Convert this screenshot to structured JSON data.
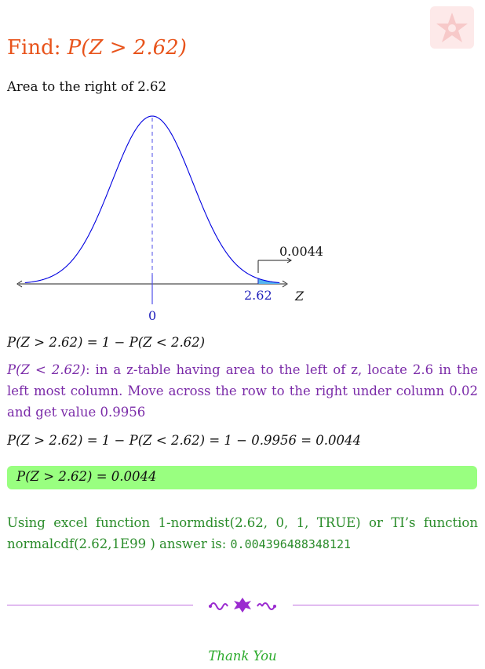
{
  "title": {
    "prefix": "Find:",
    "expression": "P(Z > 2.62)"
  },
  "subtitle": "Area to the right of 2.62",
  "graph": {
    "mean": 0,
    "z": 2.62,
    "area": 0.0044,
    "mean_label": "0",
    "z_label": "2.62",
    "area_label": "0.0044",
    "axis_label": "Z",
    "colors": {
      "curve": "#0000e0",
      "shade": "#55b4ee",
      "mean_line": "#4f4fe8",
      "labels": "#1f1fbb"
    }
  },
  "step1": "P(Z > 2.62) = 1 − P(Z < 2.62)",
  "explanation": {
    "lead": "P(Z < 2.62)",
    "text": ": in a z-table having area to the left of z, locate 2.6 in the left most column. Move across the row to the right under column 0.02 and get value 0.9956"
  },
  "step2": "P(Z > 2.62) = 1 − P(Z < 2.62) = 1 − 0.9956 = 0.0044",
  "answer": "P(Z > 2.62) = 0.0044",
  "excel": {
    "text": "Using excel function 1-normdist(2.62, 0, 1, TRUE) or TI’s function normalcdf(2.62,1E99 ) answer is: ",
    "value": "0.004396488348121"
  },
  "footer": {
    "thanks": "Thank You"
  }
}
